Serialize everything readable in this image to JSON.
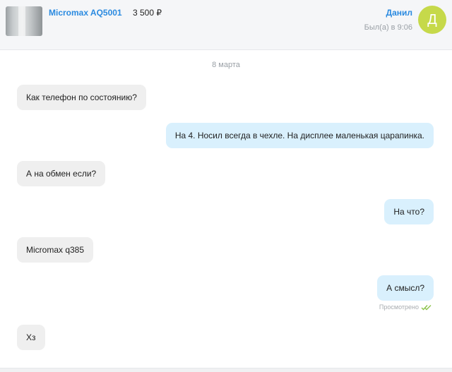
{
  "header": {
    "item_title": "Micromax AQ5001",
    "price": "3 500 ₽",
    "contact_name": "Данил",
    "last_seen": "Был(а) в 9:06",
    "avatar_letter": "Д",
    "avatar_color": "#c6d94a"
  },
  "chat": {
    "date_separator": "8 марта",
    "messages": [
      {
        "direction": "incoming",
        "text": "Как телефон по состоянию?"
      },
      {
        "direction": "outgoing",
        "text": "На 4. Носил всегда в чехле. На дисплее маленькая царапинка."
      },
      {
        "direction": "incoming",
        "text": "А на обмен если?"
      },
      {
        "direction": "outgoing",
        "text": "На что?"
      },
      {
        "direction": "incoming",
        "text": "Micromax q385"
      },
      {
        "direction": "outgoing",
        "text": "А смысл?"
      },
      {
        "direction": "incoming",
        "text": "Хз"
      }
    ],
    "read_status": "Просмотрено",
    "read_status_icon": "double-check-icon",
    "read_status_color": "#8bc34a"
  }
}
